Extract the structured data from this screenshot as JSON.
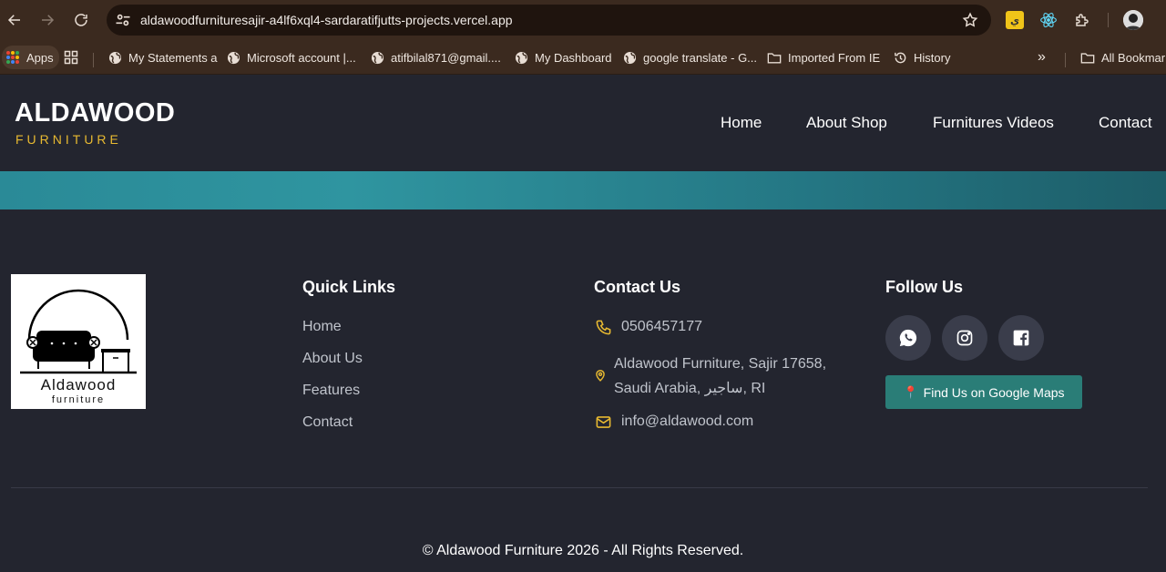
{
  "browser": {
    "url": "aldawoodfurnituresajir-a4lf6xql4-sardaratifjutts-projects.vercel.app",
    "bookmarks": [
      {
        "label": "Apps",
        "icon": "apps-grid-icon"
      },
      {
        "label": "My Statements a",
        "icon": "globe-icon"
      },
      {
        "label": "Microsoft account |...",
        "icon": "globe-icon"
      },
      {
        "label": "atifbilal871@gmail....",
        "icon": "globe-icon"
      },
      {
        "label": "My Dashboard",
        "icon": "globe-icon"
      },
      {
        "label": "google translate - G...",
        "icon": "globe-icon"
      },
      {
        "label": "Imported From IE",
        "icon": "folder-icon"
      },
      {
        "label": "History",
        "icon": "history-icon"
      },
      {
        "label": "All Bookmarks",
        "icon": "folder-icon"
      }
    ],
    "extension_badge": "ي"
  },
  "header": {
    "logo_title": "ALDAWOOD",
    "logo_subtitle": "FURNITURE",
    "nav": [
      "Home",
      "About Shop",
      "Furnitures Videos",
      "Contact"
    ]
  },
  "footer": {
    "logo_text": "Aldawood",
    "logo_subtext": "furniture",
    "quick_links_title": "Quick Links",
    "quick_links": [
      "Home",
      "About Us",
      "Features",
      "Contact"
    ],
    "contact_title": "Contact Us",
    "phone": "0506457177",
    "address": "Aldawood Furniture, Sajir 17658, Saudi Arabia, ساجير, RI",
    "email": "info@aldawood.com",
    "follow_title": "Follow Us",
    "social": [
      "whatsapp-icon",
      "instagram-icon",
      "facebook-icon"
    ],
    "maps_button": "Find Us on Google Maps",
    "copyright": "© Aldawood Furniture 2026 - All Rights Reserved."
  },
  "colors": {
    "accent": "#e7b931",
    "background": "#23252f",
    "maps_button": "#2a7d77",
    "banner": "#2a8a97"
  }
}
